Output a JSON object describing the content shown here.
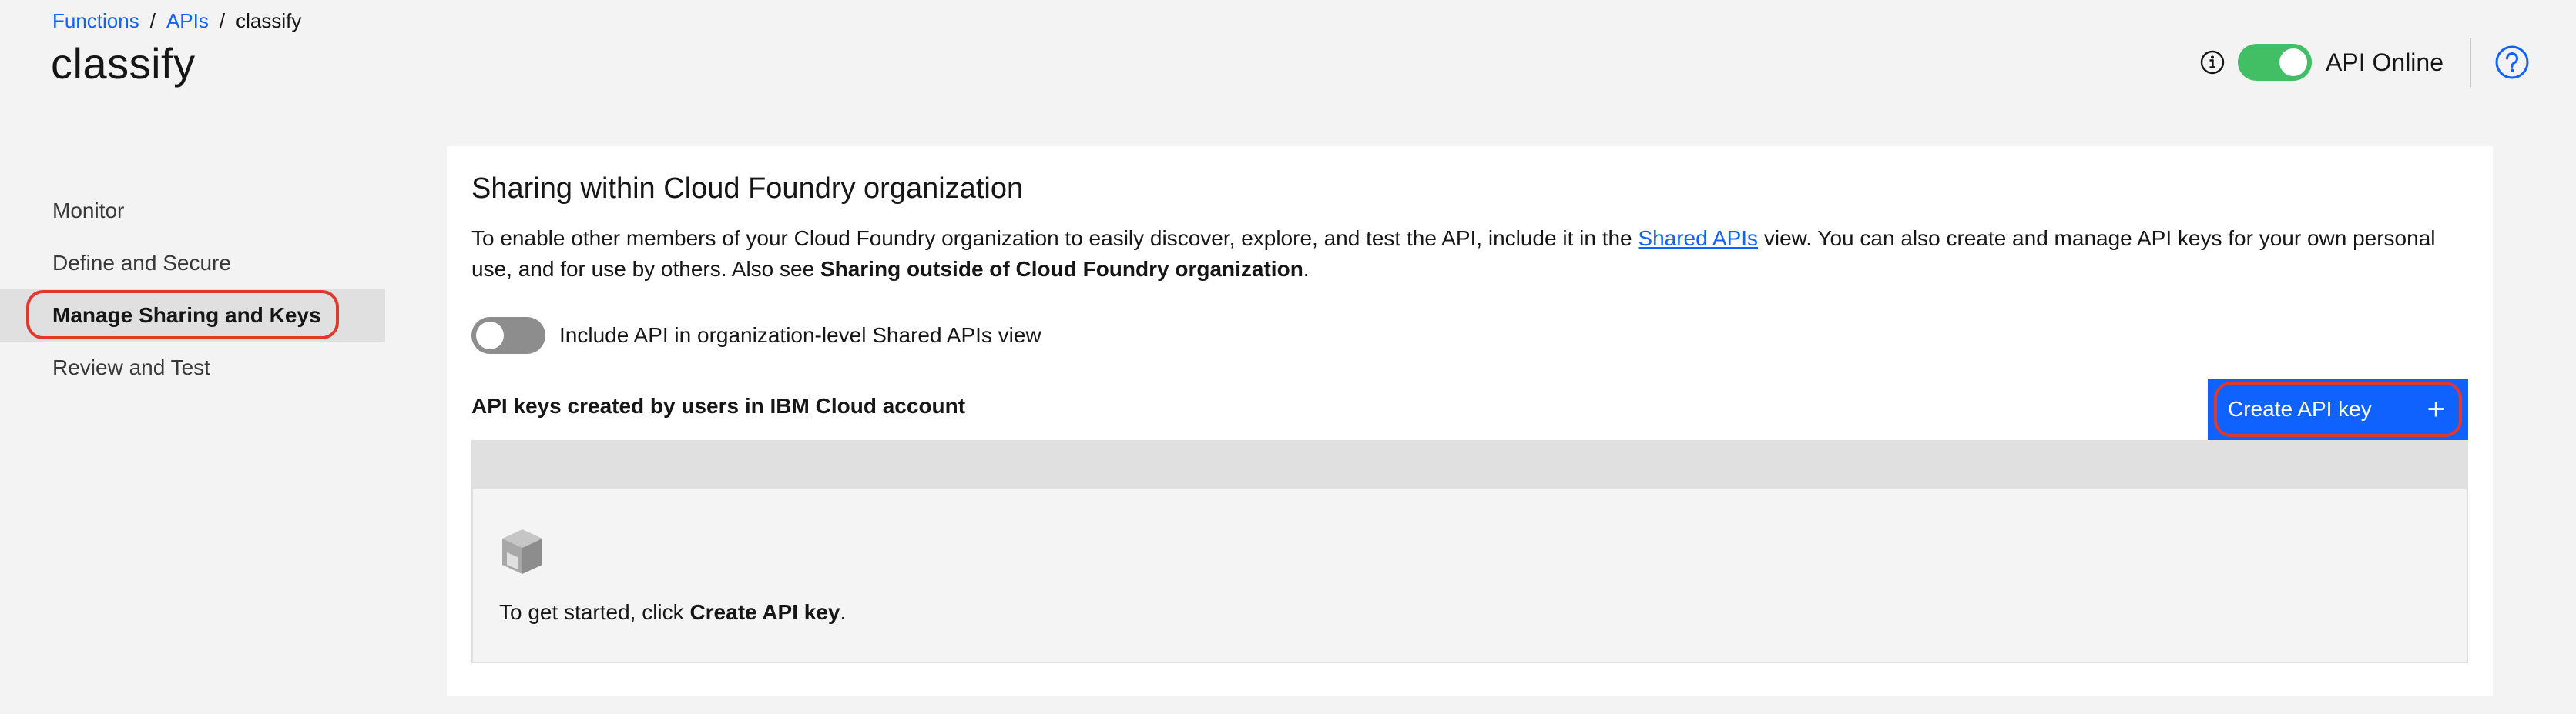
{
  "breadcrumb": {
    "functions": "Functions",
    "apis": "APIs",
    "current": "classify",
    "sep": "/"
  },
  "page": {
    "title": "classify"
  },
  "status": {
    "label": "API Online",
    "enabled": true
  },
  "sidebar": {
    "items": [
      {
        "label": "Monitor"
      },
      {
        "label": "Define and Secure"
      },
      {
        "label": "Manage Sharing and Keys"
      },
      {
        "label": "Review and Test"
      }
    ],
    "active_index": 2
  },
  "sharing": {
    "title": "Sharing within Cloud Foundry organization",
    "desc_part1": "To enable other members of your Cloud Foundry organization to easily discover, explore, and test the API, include it in the ",
    "shared_apis_link": "Shared APIs",
    "desc_part2": " view. You can also create and manage API keys for your own personal use, and for use by others. Also see ",
    "desc_bold": "Sharing outside of Cloud Foundry organization",
    "desc_end": ".",
    "toggle_label": "Include API in organization-level Shared APIs view",
    "toggle_enabled": false
  },
  "keys": {
    "title": "API keys created by users in IBM Cloud account",
    "create_label": "Create API key",
    "create_icon": "+",
    "empty_prefix": "To get started, click ",
    "empty_bold": "Create API key",
    "empty_suffix": "."
  },
  "colors": {
    "accent": "#0f62fe",
    "online": "#42be65",
    "highlight": "#e0392b"
  }
}
